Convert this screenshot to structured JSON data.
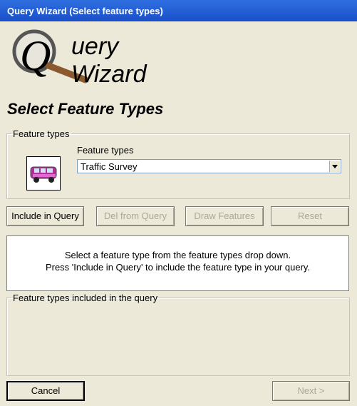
{
  "window": {
    "title": "Query Wizard (Select feature types)"
  },
  "logo": {
    "text": "uery Wizard",
    "letter": "Q"
  },
  "page": {
    "heading": "Select Feature Types"
  },
  "feature_group": {
    "legend": "Feature types",
    "label": "Feature types",
    "selected_value": "Traffic Survey",
    "icon": "van-icon"
  },
  "buttons": {
    "include": "Include in Query",
    "delete": "Del from Query",
    "draw": "Draw Features",
    "reset": "Reset",
    "cancel": "Cancel",
    "next": "Next >"
  },
  "info": {
    "line1": "Select a feature type from the feature types drop down.",
    "line2": "Press 'Include in Query' to include the feature type in your query."
  },
  "included_group": {
    "legend": "Feature types included in the query"
  }
}
